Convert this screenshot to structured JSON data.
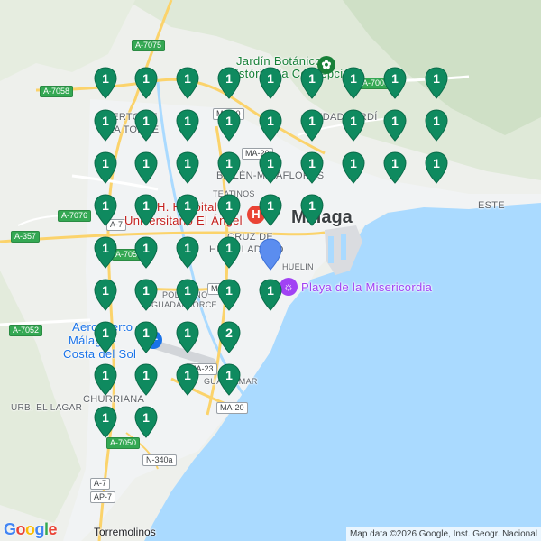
{
  "map": {
    "cities": {
      "malaga": "Málaga",
      "torremolinos": "Torremolinos"
    },
    "neighborhoods": {
      "churriana": "CHURRIANA",
      "urb_el_lagar": "URB. EL LAGAR",
      "teatinos": "TEATINOS",
      "este": "ESTE",
      "huelin": "HUELIN",
      "puerto_de_la_torre_1": "UERTO DE",
      "puerto_de_la_torre_2": "LA TORRE",
      "ciudad_jardin": "JDAD JARDÍ",
      "bailen_miraflores": "BAILÉN-MIRAFLORES",
      "cruz_humilladero_1": "CRUZ DE",
      "cruz_humilladero_2": "HUMILLADERO",
      "poligono_1": "POLÍGONO",
      "poligono_2": "GUADALHORCE",
      "guadalmar": "GUADALMAR"
    },
    "pois": {
      "hospital_1": "H. Hospital",
      "hospital_2": "Universitario El Ángel",
      "beach": "Playa de la Misericordia",
      "garden_1": "Jardín Botánico",
      "garden_2": "Histórico la Concepción",
      "airport_1": "Aeropuerto de",
      "airport_2": "Málaga -",
      "airport_3": "Costa del Sol"
    },
    "roads": {
      "a7075": "A-7075",
      "a7058": "A-7058",
      "a7000": "A-7000",
      "a7076": "A-7076",
      "a357": "A-357",
      "a7052": "A-7052",
      "a7050": "A-7050",
      "a7054": "A-7054",
      "a7": "A-7",
      "ap7": "AP-7",
      "ma20": "MA-20",
      "ma20b": "MA-20",
      "ma21": "MA-21",
      "ma20c": "MA-20",
      "ma23": "MA-23",
      "n340a": "N-340a"
    },
    "markers": [
      {
        "n": "1"
      },
      {
        "n": "1"
      },
      {
        "n": "1"
      },
      {
        "n": "1"
      },
      {
        "n": "1"
      },
      {
        "n": "1"
      },
      {
        "n": "1"
      },
      {
        "n": "1"
      },
      {
        "n": "1"
      },
      {
        "n": "1"
      },
      {
        "n": "1"
      },
      {
        "n": "1"
      },
      {
        "n": "1"
      },
      {
        "n": "1"
      },
      {
        "n": "1"
      },
      {
        "n": "1"
      },
      {
        "n": "1"
      },
      {
        "n": "1"
      },
      {
        "n": "1"
      },
      {
        "n": "1"
      },
      {
        "n": "1"
      },
      {
        "n": "1"
      },
      {
        "n": "1"
      },
      {
        "n": "1"
      },
      {
        "n": "1"
      },
      {
        "n": "1"
      },
      {
        "n": "1"
      },
      {
        "n": "1"
      },
      {
        "n": "1"
      },
      {
        "n": "1"
      },
      {
        "n": "1"
      },
      {
        "n": "1"
      },
      {
        "n": "1"
      },
      {
        "n": "1"
      },
      {
        "n": "1"
      },
      {
        "n": "1"
      },
      {
        "n": "1"
      },
      {
        "n": "1"
      },
      {
        "n": "1"
      },
      {
        "n": "1"
      },
      {
        "n": "1"
      },
      {
        "n": "1"
      },
      {
        "n": "1"
      },
      {
        "n": "1"
      },
      {
        "n": "1"
      },
      {
        "n": "2"
      },
      {
        "n": "1"
      },
      {
        "n": "1"
      },
      {
        "n": "1"
      },
      {
        "n": "1"
      },
      {
        "n": "1"
      },
      {
        "n": "1"
      }
    ],
    "marker_color": "#0f8a5f",
    "location_color": "#4285f4",
    "logo": "Google",
    "attribution": "Map data ©2026 Google, Inst. Geogr. Nacional"
  }
}
